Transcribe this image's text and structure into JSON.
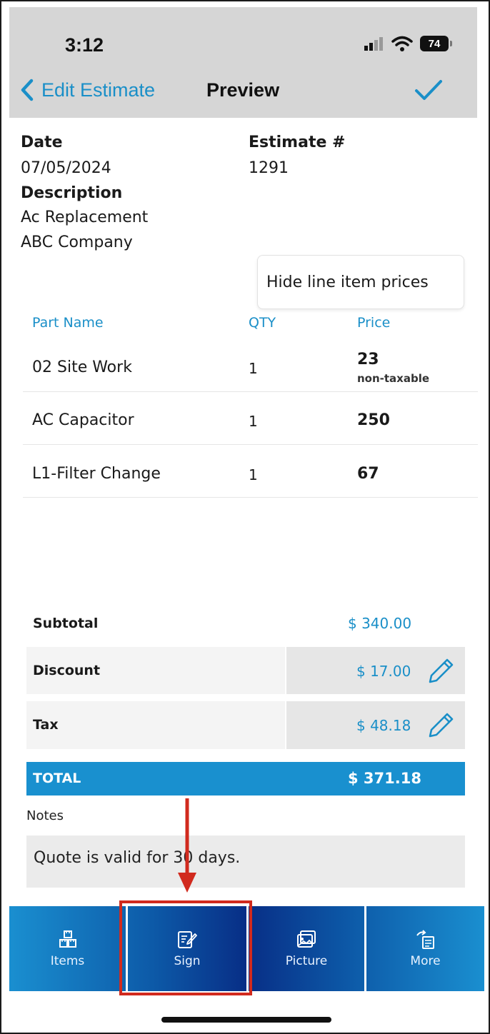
{
  "status_bar": {
    "time": "3:12",
    "battery": "74"
  },
  "nav": {
    "back_label": "Edit Estimate",
    "title": "Preview"
  },
  "estimate": {
    "date_label": "Date",
    "date_value": "07/05/2024",
    "number_label": "Estimate #",
    "number_value": "1291",
    "description_label": "Description",
    "description_lines": [
      "Ac Replacement",
      "ABC Company"
    ]
  },
  "hide_prices_label": "Hide line item prices",
  "table": {
    "headers": {
      "part": "Part Name",
      "qty": "QTY",
      "price": "Price"
    },
    "rows": [
      {
        "name": "02 Site Work",
        "qty": "1",
        "price": "23",
        "note": "non-taxable"
      },
      {
        "name": "AC Capacitor",
        "qty": "1",
        "price": "250",
        "note": ""
      },
      {
        "name": "L1-Filter Change",
        "qty": "1",
        "price": "67",
        "note": ""
      }
    ]
  },
  "summary": {
    "subtotal_label": "Subtotal",
    "subtotal_value": "$ 340.00",
    "discount_label": "Discount",
    "discount_value": "$ 17.00",
    "tax_label": "Tax",
    "tax_value": "$ 48.18",
    "total_label": "TOTAL",
    "total_value": "$ 371.18"
  },
  "notes": {
    "label": "Notes",
    "text": "Quote is valid for 30 days."
  },
  "tabs": [
    {
      "label": "Items",
      "icon": "items-icon"
    },
    {
      "label": "Sign",
      "icon": "sign-icon"
    },
    {
      "label": "Picture",
      "icon": "picture-icon"
    },
    {
      "label": "More",
      "icon": "more-icon"
    }
  ],
  "colors": {
    "accent": "#1a8fc8",
    "total_bar": "#1990cf",
    "highlight": "#d12a1e",
    "tab_dark": "#082e86"
  }
}
